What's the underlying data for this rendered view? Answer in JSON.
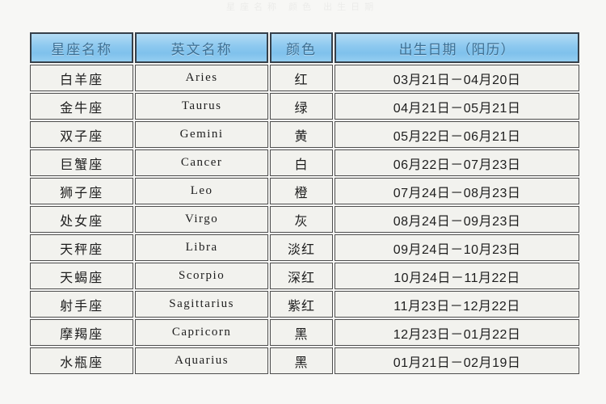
{
  "page": {
    "background_color": "#f7f7f5",
    "ghost_row_text": "星座名称  颜色  出生日期"
  },
  "table": {
    "header_bg_color": "#8cc8ef",
    "header_text_color": "#3c6f93",
    "cell_bg_color": "#f2f2ee",
    "border_color": "#4e4e4e",
    "columns": [
      {
        "key": "name",
        "label": "星座名称"
      },
      {
        "key": "en",
        "label": "英文名称"
      },
      {
        "key": "color",
        "label": "颜色"
      },
      {
        "key": "date",
        "label": "出生日期（阳历）"
      }
    ],
    "rows": [
      {
        "name": "白羊座",
        "en": "Aries",
        "color": "红",
        "date": "03月21日－04月20日"
      },
      {
        "name": "金牛座",
        "en": "Taurus",
        "color": "绿",
        "date": "04月21日－05月21日"
      },
      {
        "name": "双子座",
        "en": "Gemini",
        "color": "黄",
        "date": "05月22日－06月21日"
      },
      {
        "name": "巨蟹座",
        "en": "Cancer",
        "color": "白",
        "date": "06月22日－07月23日"
      },
      {
        "name": "狮子座",
        "en": "Leo",
        "color": "橙",
        "date": "07月24日－08月23日"
      },
      {
        "name": "处女座",
        "en": "Virgo",
        "color": "灰",
        "date": "08月24日－09月23日"
      },
      {
        "name": "天秤座",
        "en": "Libra",
        "color": "淡红",
        "date": "09月24日－10月23日"
      },
      {
        "name": "天蝎座",
        "en": "Scorpio",
        "color": "深红",
        "date": "10月24日－11月22日"
      },
      {
        "name": "射手座",
        "en": "Sagittarius",
        "color": "紫红",
        "date": "11月23日－12月22日"
      },
      {
        "name": "摩羯座",
        "en": "Capricorn",
        "color": "黑",
        "date": "12月23日－01月22日"
      },
      {
        "name": "水瓶座",
        "en": "Aquarius",
        "color": "黑",
        "date": "01月21日－02月19日"
      }
    ]
  }
}
